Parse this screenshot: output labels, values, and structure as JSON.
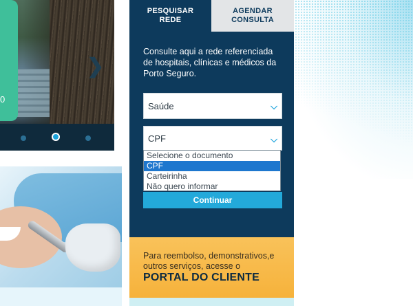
{
  "carousel": {
    "green_card_text": "0",
    "arrow_icon": "chevron-right-icon",
    "dots": [
      "",
      "active",
      ""
    ]
  },
  "tabs": [
    {
      "label": "PESQUISAR\nREDE",
      "active": true
    },
    {
      "label": "AGENDAR\nCONSULTA",
      "active": false
    }
  ],
  "search": {
    "intro": "Consulte aqui a rede referenciada de hospitais, clínicas e médicos da Porto Seguro.",
    "service_value": "Saúde",
    "document_value": "CPF",
    "document_options": [
      "Selecione o documento",
      "CPF",
      "Carteirinha",
      "Não quero informar"
    ],
    "selected_option": "CPF",
    "continue_label": "Continuar"
  },
  "portal": {
    "subtitle": "Para reembolso, demonstrativos,e outros serviços, acesse o",
    "title": "PORTAL DO CLIENTE"
  },
  "colors": {
    "panel": "#0d3a5c",
    "accent": "#23a9da",
    "portal": "#f6b23b",
    "tab_inactive": "#e3e5e7"
  }
}
